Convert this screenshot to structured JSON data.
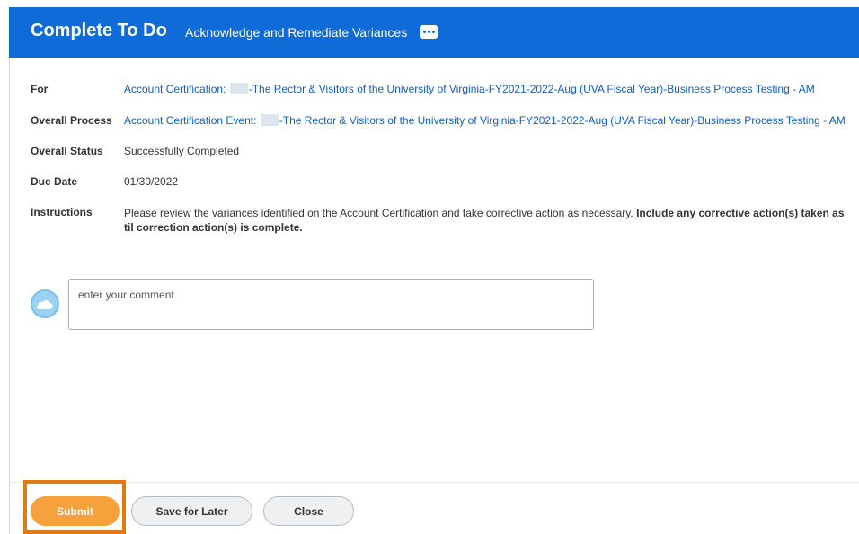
{
  "header": {
    "title": "Complete To Do",
    "subtitle": "Acknowledge and Remediate Variances",
    "more_icon": "ellipsis-icon",
    "background_color": "#0f6bd7"
  },
  "fields": {
    "for": {
      "label": "For",
      "prefix": "Account Certification: ",
      "suffix": "-The Rector & Visitors of the University of Virginia-FY2021-2022-Aug (UVA Fiscal Year)-Business Process Testing - AM"
    },
    "overall_process": {
      "label": "Overall Process",
      "prefix": "Account Certification Event: ",
      "suffix": "-The Rector & Visitors of the University of Virginia-FY2021-2022-Aug (UVA Fiscal Year)-Business Process Testing - AM"
    },
    "overall_status": {
      "label": "Overall Status",
      "value": "Successfully Completed"
    },
    "due_date": {
      "label": "Due Date",
      "value": "01/30/2022"
    },
    "instructions": {
      "label": "Instructions",
      "line1_normal": "Please review the variances identified on the Account Certification and take corrective action as necessary. ",
      "line1_bold": "Include any corrective action(s) taken as",
      "line2_bold": "til correction action(s) is complete."
    }
  },
  "comment": {
    "placeholder": "enter your comment",
    "value": "",
    "avatar_icon": "cloud-avatar-icon"
  },
  "footer": {
    "submit_label": "Submit",
    "save_label": "Save for Later",
    "close_label": "Close",
    "submit_color": "#f6a13b",
    "highlight_color": "#e07a14"
  }
}
